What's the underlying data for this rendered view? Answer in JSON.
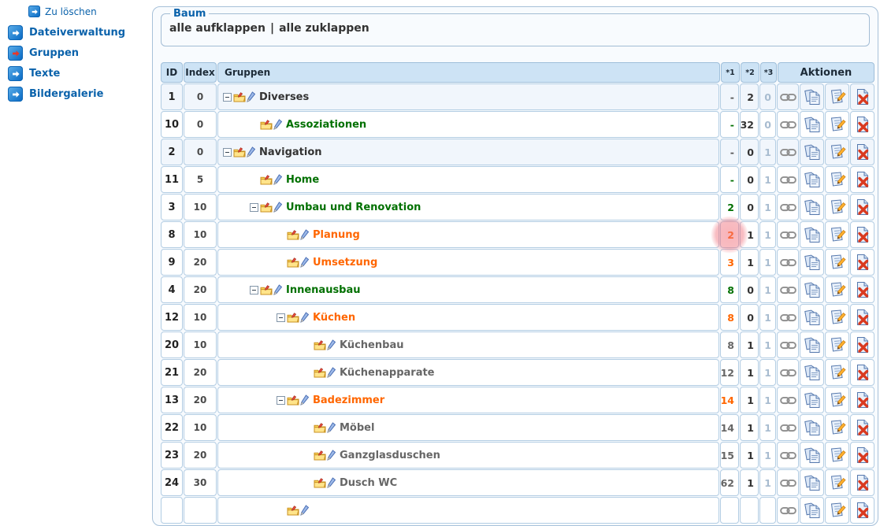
{
  "sidebar": {
    "items": [
      {
        "label": "Zu löschen",
        "icon": "arrow-right-icon",
        "small": true,
        "active": false
      },
      {
        "label": "Dateiverwaltung",
        "icon": "arrow-right-icon",
        "small": false,
        "active": false
      },
      {
        "label": "Gruppen",
        "icon": "arrow-right-icon",
        "small": false,
        "active": true
      },
      {
        "label": "Texte",
        "icon": "arrow-right-icon",
        "small": false,
        "active": false
      },
      {
        "label": "Bildergalerie",
        "icon": "arrow-right-icon",
        "small": false,
        "active": false
      }
    ]
  },
  "panel": {
    "fieldset_legend": "Baum",
    "links": [
      "alle aufklappen",
      "alle zuklappen"
    ],
    "links_separator": "|"
  },
  "table": {
    "headers": {
      "id": "ID",
      "index": "Index",
      "group": "Gruppen",
      "actions": "Aktionen"
    },
    "small_headers": [
      "*1",
      "*2",
      "*3"
    ],
    "action_icons": [
      "link-icon",
      "copy-icon",
      "edit-icon",
      "delete-icon"
    ],
    "row_icons": [
      "collapse-toggle-icon",
      "folder-icon",
      "pen-icon"
    ],
    "rows": [
      {
        "id": "1",
        "index": "0",
        "label": "Diverses",
        "level": 0,
        "toggle": true,
        "color": "dark",
        "shaded": true,
        "c1": "-",
        "c2": "2",
        "c3": "0"
      },
      {
        "id": "10",
        "index": "0",
        "label": "Assoziationen",
        "level": 1,
        "toggle": false,
        "color": "green",
        "shaded": false,
        "c1": "-",
        "c2": "32",
        "c3": "0"
      },
      {
        "id": "2",
        "index": "0",
        "label": "Navigation",
        "level": 0,
        "toggle": true,
        "color": "dark",
        "shaded": true,
        "c1": "-",
        "c2": "0",
        "c3": "1"
      },
      {
        "id": "11",
        "index": "5",
        "label": "Home",
        "level": 1,
        "toggle": false,
        "color": "green",
        "shaded": false,
        "c1": "-",
        "c2": "0",
        "c3": "1"
      },
      {
        "id": "3",
        "index": "10",
        "label": "Umbau und Renovation",
        "level": 1,
        "toggle": true,
        "color": "green",
        "shaded": false,
        "c1": "2",
        "c2": "0",
        "c3": "1"
      },
      {
        "id": "8",
        "index": "10",
        "label": "Planung",
        "level": 2,
        "toggle": false,
        "color": "orange",
        "shaded": false,
        "c1": "2",
        "c2": "1",
        "c3": "1",
        "highlight": true
      },
      {
        "id": "9",
        "index": "20",
        "label": "Umsetzung",
        "level": 2,
        "toggle": false,
        "color": "orange",
        "shaded": false,
        "c1": "3",
        "c2": "1",
        "c3": "1"
      },
      {
        "id": "4",
        "index": "20",
        "label": "Innenausbau",
        "level": 1,
        "toggle": true,
        "color": "green",
        "shaded": false,
        "c1": "8",
        "c2": "0",
        "c3": "1"
      },
      {
        "id": "12",
        "index": "10",
        "label": "Küchen",
        "level": 2,
        "toggle": true,
        "color": "orange",
        "shaded": false,
        "c1": "8",
        "c2": "0",
        "c3": "1"
      },
      {
        "id": "20",
        "index": "10",
        "label": "Küchenbau",
        "level": 3,
        "toggle": false,
        "color": "gray",
        "shaded": false,
        "c1": "8",
        "c2": "1",
        "c3": "1"
      },
      {
        "id": "21",
        "index": "20",
        "label": "Küchenapparate",
        "level": 3,
        "toggle": false,
        "color": "gray",
        "shaded": false,
        "c1": "12",
        "c2": "1",
        "c3": "1"
      },
      {
        "id": "13",
        "index": "20",
        "label": "Badezimmer",
        "level": 2,
        "toggle": true,
        "color": "orange",
        "shaded": false,
        "c1": "14",
        "c2": "1",
        "c3": "1"
      },
      {
        "id": "22",
        "index": "10",
        "label": "Möbel",
        "level": 3,
        "toggle": false,
        "color": "gray",
        "shaded": false,
        "c1": "14",
        "c2": "1",
        "c3": "1"
      },
      {
        "id": "23",
        "index": "20",
        "label": "Ganzglasduschen",
        "level": 3,
        "toggle": false,
        "color": "gray",
        "shaded": false,
        "c1": "15",
        "c2": "1",
        "c3": "1"
      },
      {
        "id": "24",
        "index": "30",
        "label": "Dusch WC",
        "level": 3,
        "toggle": false,
        "color": "gray",
        "shaded": false,
        "c1": "62",
        "c2": "1",
        "c3": "1"
      },
      {
        "id": "",
        "index": "",
        "label": "",
        "level": 2,
        "toggle": false,
        "color": "gray",
        "shaded": false,
        "c1": "",
        "c2": "",
        "c3": "",
        "partial": true
      }
    ]
  },
  "colors": {
    "sidebar_link": "#0a62ab",
    "legend_blue": "#0a62ab",
    "header_bg": "#cde3f5",
    "cell_border": "#b3cde3",
    "shaded_row_bg": "#f1f6fc",
    "green": "#007000",
    "orange": "#ff6600",
    "click_highlight": "#f06e7a"
  },
  "overlay": {
    "click_highlight_on": "Planung *1 cell"
  }
}
